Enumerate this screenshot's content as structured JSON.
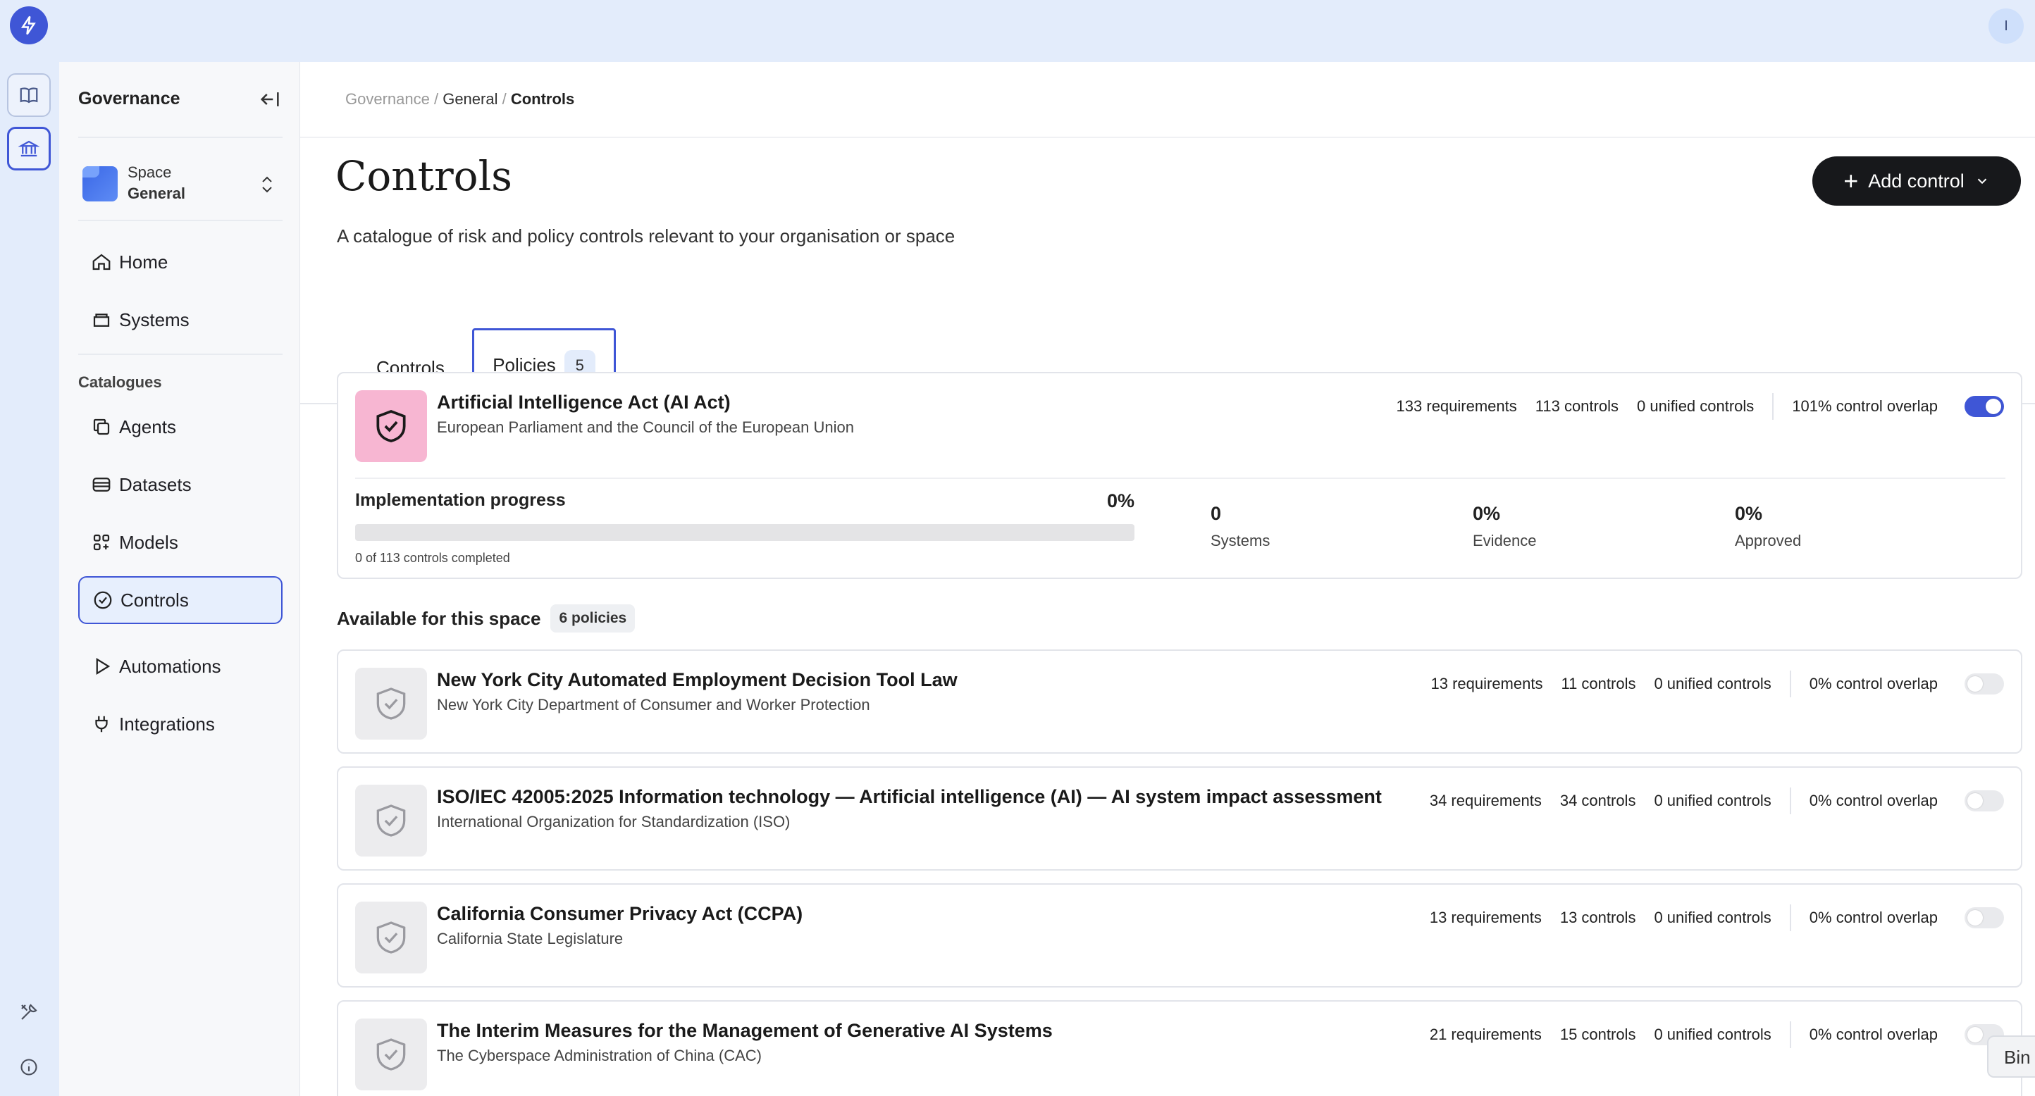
{
  "topbar": {
    "avatar_initial": "I"
  },
  "sidebar": {
    "title": "Governance",
    "space": {
      "label": "Space",
      "name": "General"
    },
    "nav_main": [
      {
        "label": "Home",
        "icon": "home-icon"
      },
      {
        "label": "Systems",
        "icon": "systems-icon"
      }
    ],
    "section_label": "Catalogues",
    "nav_catalogues": [
      {
        "label": "Agents",
        "icon": "agents-icon"
      },
      {
        "label": "Datasets",
        "icon": "datasets-icon"
      },
      {
        "label": "Models",
        "icon": "models-icon"
      },
      {
        "label": "Controls",
        "icon": "controls-icon",
        "active": true
      }
    ],
    "nav_other": [
      {
        "label": "Automations",
        "icon": "play-icon"
      },
      {
        "label": "Integrations",
        "icon": "plug-icon"
      }
    ]
  },
  "breadcrumb": {
    "root": "Governance",
    "middle": "General",
    "current": "Controls"
  },
  "page": {
    "title": "Controls",
    "description": "A catalogue of risk and policy controls relevant to your organisation or space",
    "add_button": "Add control"
  },
  "tabs": {
    "controls": "Controls",
    "policies": "Policies",
    "policies_count": "5"
  },
  "active_policy": {
    "title": "Artificial Intelligence Act (AI Act)",
    "subtitle": "European Parliament and the Council of the European Union",
    "requirements": "133 requirements",
    "controls": "113 controls",
    "unified": "0 unified controls",
    "overlap": "101% control overlap",
    "enabled": true,
    "progress_label": "Implementation progress",
    "progress_pct": "0%",
    "progress_fraction": 0,
    "progress_caption": "0 of 113 controls completed",
    "metrics": [
      {
        "value": "0",
        "label": "Systems"
      },
      {
        "value": "0%",
        "label": "Evidence"
      },
      {
        "value": "0%",
        "label": "Approved"
      }
    ]
  },
  "available": {
    "label": "Available for this space",
    "count": "6 policies",
    "policies": [
      {
        "title": "New York City Automated Employment Decision Tool Law",
        "subtitle": "New York City Department of Consumer and Worker Protection",
        "requirements": "13 requirements",
        "controls": "11 controls",
        "unified": "0 unified controls",
        "overlap": "0% control overlap"
      },
      {
        "title": "ISO/IEC 42005:2025 Information technology — Artificial intelligence (AI) — AI system impact assessment",
        "subtitle": "International Organization for Standardization (ISO)",
        "requirements": "34 requirements",
        "controls": "34 controls",
        "unified": "0 unified controls",
        "overlap": "0% control overlap"
      },
      {
        "title": "California Consumer Privacy Act (CCPA)",
        "subtitle": "California State Legislature",
        "requirements": "13 requirements",
        "controls": "13 controls",
        "unified": "0 unified controls",
        "overlap": "0% control overlap"
      },
      {
        "title": "The Interim Measures for the Management of Generative AI Systems",
        "subtitle": "The Cyberspace Administration of China (CAC)",
        "requirements": "21 requirements",
        "controls": "15 controls",
        "unified": "0 unified controls",
        "overlap": "0% control overlap"
      }
    ]
  },
  "floating_tip": "Bin",
  "colors": {
    "accent": "#3f56d6",
    "active_policy_icon_bg": "#f7b6d2",
    "primary_button": "#17181b"
  }
}
